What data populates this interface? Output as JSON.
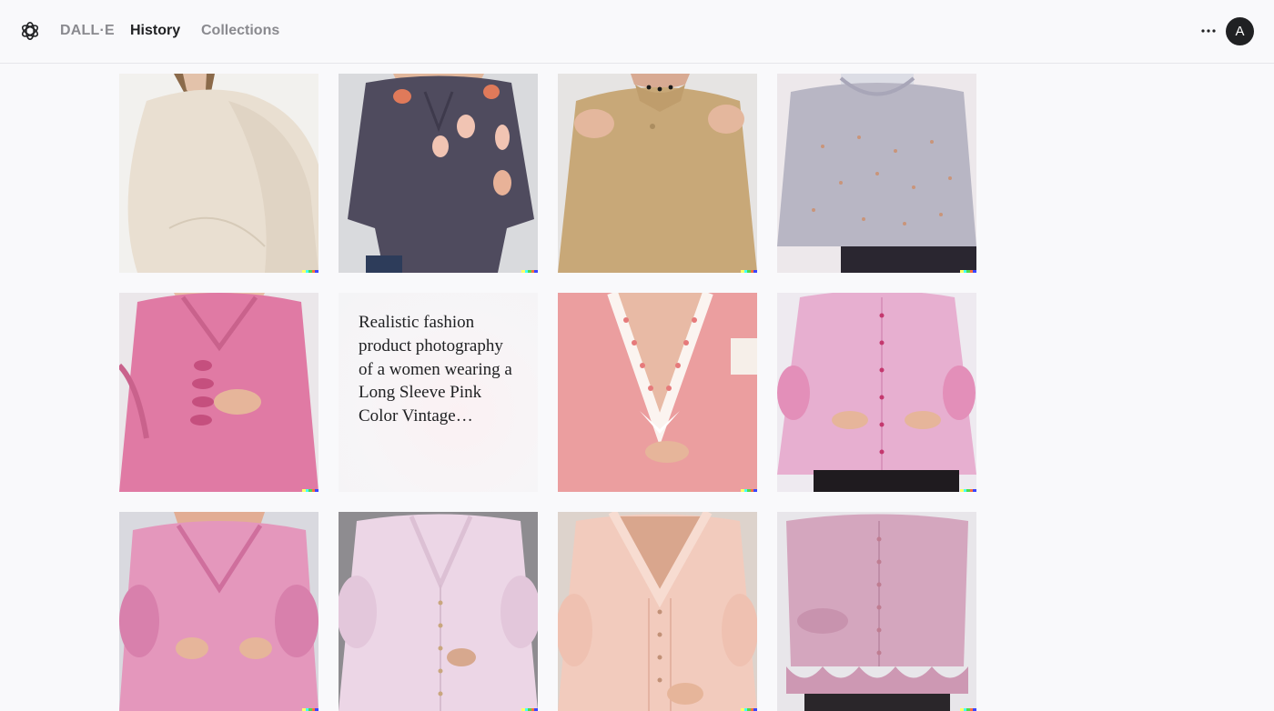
{
  "header": {
    "brand": "DALL·E",
    "nav": [
      {
        "label": "History",
        "active": true
      },
      {
        "label": "Collections",
        "active": false
      }
    ],
    "more_icon": "ellipsis-icon",
    "avatar_initial": "A"
  },
  "colors": {
    "text_primary": "#202123",
    "text_muted": "#8a8a8f",
    "background": "#f9f9fb",
    "watermark": [
      "#ffff66",
      "#42ffff",
      "#51da4c",
      "#ff6e3c",
      "#3c46ff"
    ]
  },
  "grid": {
    "prompt_tile": {
      "text": "Realistic fashion product photography of a women wearing a Long Sleeve Pink Color Vintage…"
    },
    "images": [
      {
        "name": "image-cream-sweater"
      },
      {
        "name": "image-charcoal-blouse-floral"
      },
      {
        "name": "image-tan-collared-top"
      },
      {
        "name": "image-grey-dotted-sweater"
      },
      {
        "name": "image-pink-ruffle-blouse"
      },
      {
        "name": "image-pink-deep-v-blouse"
      },
      {
        "name": "image-pink-button-blouse"
      },
      {
        "name": "image-pink-satin-blouse"
      },
      {
        "name": "image-light-pink-buttoned-blouse"
      },
      {
        "name": "image-peach-vintage-blouse"
      },
      {
        "name": "image-mauve-peplum-blouse"
      }
    ]
  }
}
